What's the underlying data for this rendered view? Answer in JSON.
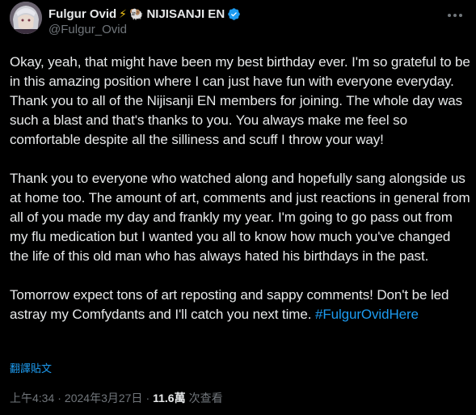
{
  "author": {
    "display_name": "Fulgur Ovid",
    "emoji": [
      "⚡",
      "🐏"
    ],
    "org": "NIJISANJI EN",
    "handle": "@Fulgur_Ovid",
    "avatar_icon": "avatar-image",
    "verified_icon": "verified-badge-icon",
    "verified_color": "#1d9bf0"
  },
  "more_icon": "more-options-icon",
  "body": {
    "paragraph1": "Okay, yeah, that might have been my best birthday ever. I'm so grateful to be in this amazing position where I can just have fun with everyone everyday. Thank you to all of the Nijisanji EN members for joining. The whole day was such a blast and that's thanks to you. You always make me feel so comfortable despite all the silliness and scuff I throw your way!",
    "paragraph2": "Thank you to everyone who watched along and hopefully sang alongside us at home too. The amount of art, comments and just reactions in general from all of you made my day and frankly my year. I'm going to go pass out from my flu medication but I wanted you all to know how much you've changed the life of this old man who has always hated his birthdays in the past.",
    "paragraph3_text": "Tomorrow expect tons of art reposting and sappy comments! Don't be led astray my Comfydants and I'll catch you next time. ",
    "hashtag": "#FulgurOvidHere"
  },
  "translate_label": "翻譯貼文",
  "meta": {
    "time": "上午4:34",
    "separator": "·",
    "date": "2024年3月27日",
    "views_count": "11.6萬",
    "views_label": "次查看"
  },
  "colors": {
    "background": "#000000",
    "text": "#e7e9ea",
    "secondary": "#71767b",
    "accent": "#1d9bf0"
  }
}
